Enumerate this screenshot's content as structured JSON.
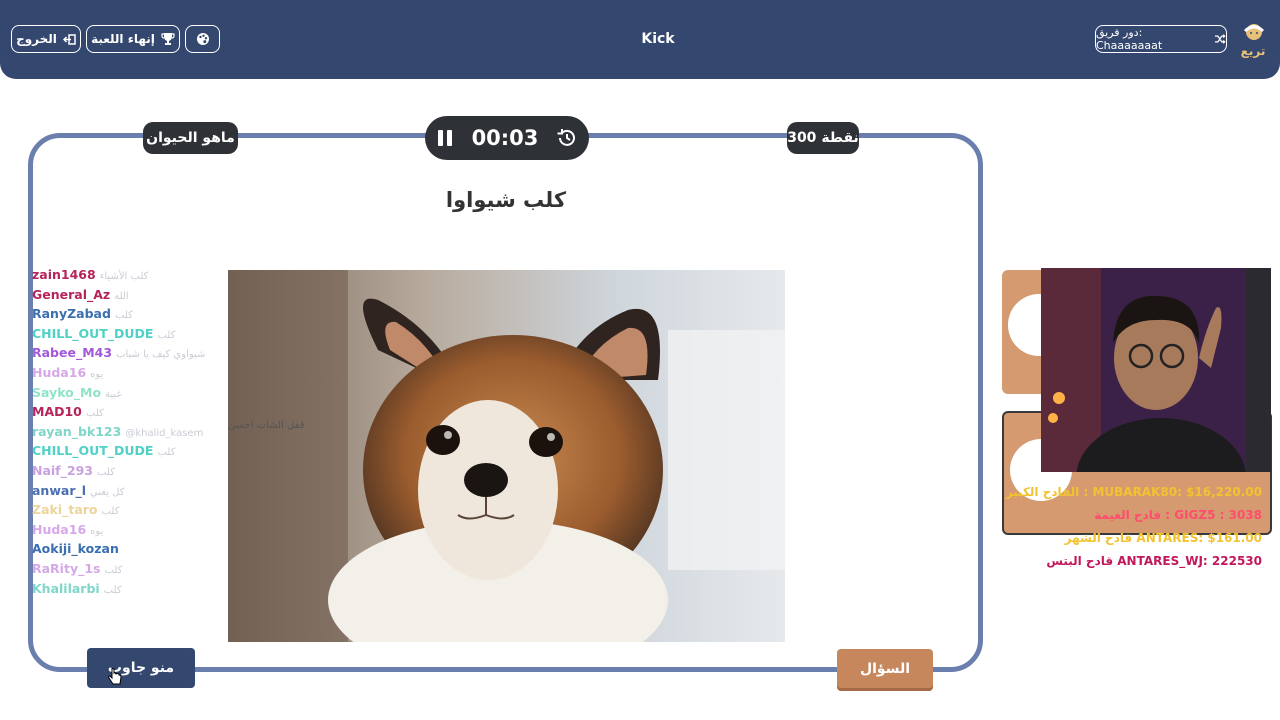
{
  "header": {
    "title": "Kick",
    "exit_label": "الخروج",
    "end_game_label": "إنهاء اللعبة",
    "turn_label": "دور فريق: Chaaaaaaat",
    "logo_text": "تريع"
  },
  "board": {
    "category": "ماهو الحيوان",
    "points": "300 نقطة",
    "timer": "00:03",
    "answer": "كلب شيواوا",
    "who_answered_label": "منو جاوب",
    "question_label": "السؤال"
  },
  "chat": {
    "overlay_text": "قفل الشات احسن",
    "messages": [
      {
        "user": "zain1468",
        "color": "#b5245a",
        "text": "كلب الأشياء"
      },
      {
        "user": "General_Az",
        "color": "#b5245a",
        "text": "الله"
      },
      {
        "user": "RanyZabad",
        "color": "#3a6fb0",
        "text": "كلب"
      },
      {
        "user": "CHILL_OUT_DUDE",
        "color": "#4fd1c5",
        "text": "كلب"
      },
      {
        "user": "Rabee_M43",
        "color": "#a259d9",
        "text": "شيواوي كيف يا شباب"
      },
      {
        "user": "Huda16",
        "color": "#d6a8e8",
        "text": "يوه"
      },
      {
        "user": "Sayko_Mo",
        "color": "#8fe3c7",
        "text": "غبية"
      },
      {
        "user": "MAD10",
        "color": "#b5245a",
        "text": "كلب"
      },
      {
        "user": "rayan_bk123",
        "color": "#7fd6c9",
        "text": "@khalid_kasem"
      },
      {
        "user": "CHILL_OUT_DUDE",
        "color": "#4fd1c5",
        "text": "كلب"
      },
      {
        "user": "Naif_293",
        "color": "#c9a0e0",
        "text": "كلب"
      },
      {
        "user": "anwar_l",
        "color": "#4a6fb0",
        "text": "كل يعني"
      },
      {
        "user": "Zaki_taro",
        "color": "#ecd49a",
        "text": "كلب"
      },
      {
        "user": "Huda16",
        "color": "#d6a8e8",
        "text": "يوه"
      },
      {
        "user": "Aokiji_kozan",
        "color": "#3a6fb0",
        "text": ""
      },
      {
        "user": "RaRity_1s",
        "color": "#d6a8e8",
        "text": "كلب"
      },
      {
        "user": "Khalilarbi",
        "color": "#7fd6c9",
        "text": "كلب"
      }
    ]
  },
  "stats": [
    {
      "text": "القادح الكبير : MUBARAK80: $16,220.00",
      "color": "#f2c230"
    },
    {
      "text": "قادح الغيمة : GIGZ5 : 3038",
      "color": "#ff4d6d"
    },
    {
      "text": "قادح الشهر ANTARES: $161.00",
      "color": "#f2c230"
    },
    {
      "text": "قادح البتس ANTARES_WJ: 222530",
      "color": "#c2185b"
    }
  ],
  "colors": {
    "header_bg": "#34476f",
    "board_border": "#6b7fae",
    "question_button": "#c7875c"
  }
}
